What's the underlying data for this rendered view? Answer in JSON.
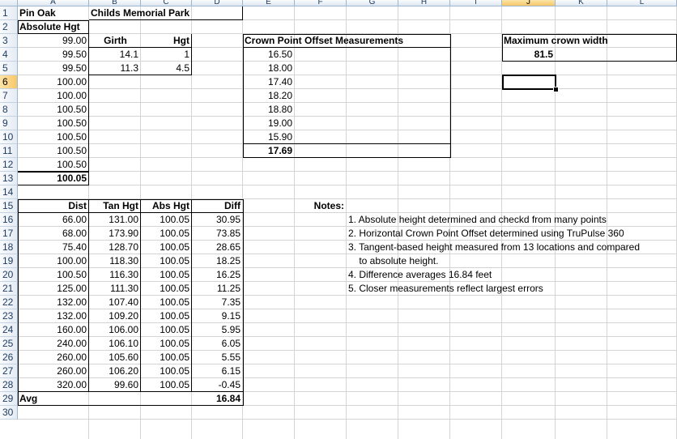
{
  "columns": [
    "A",
    "B",
    "C",
    "D",
    "E",
    "F",
    "G",
    "H",
    "I",
    "J",
    "K",
    "L"
  ],
  "rows": [
    "1",
    "2",
    "3",
    "4",
    "5",
    "6",
    "7",
    "8",
    "9",
    "10",
    "11",
    "12",
    "13",
    "14",
    "15",
    "16",
    "17",
    "18",
    "19",
    "20",
    "21",
    "22",
    "23",
    "24",
    "25",
    "26",
    "27",
    "28",
    "29",
    "30"
  ],
  "selected_cell": {
    "col": "J",
    "row": "6"
  },
  "header": {
    "species": "Pin Oak",
    "location": "Childs Memorial Park",
    "abs_hgt_label": "Absolute Hgt"
  },
  "absolute_heights": [
    "99.00",
    "99.50",
    "99.50",
    "100.00",
    "100.00",
    "100.50",
    "100.50",
    "100.50",
    "100.50",
    "100.50"
  ],
  "absolute_avg": "100.05",
  "girth_table": {
    "girth_label": "Girth",
    "hgt_label": "Hgt",
    "rows": [
      {
        "girth": "14.1",
        "hgt": "1"
      },
      {
        "girth": "11.3",
        "hgt": "4.5"
      }
    ]
  },
  "crown_offsets": {
    "title": "Crown Point Offset Measurements",
    "values": [
      "16.50",
      "18.00",
      "17.40",
      "18.20",
      "18.80",
      "19.00",
      "15.90"
    ],
    "average": "17.69"
  },
  "max_crown": {
    "title": "Maximum crown width",
    "value": "81.5"
  },
  "tan_table": {
    "headers": {
      "dist": "Dist",
      "tan": "Tan Hgt",
      "abs": "Abs Hgt",
      "diff": "Diff"
    },
    "rows": [
      {
        "dist": "66.00",
        "tan": "131.00",
        "abs": "100.05",
        "diff": "30.95"
      },
      {
        "dist": "68.00",
        "tan": "173.90",
        "abs": "100.05",
        "diff": "73.85"
      },
      {
        "dist": "75.40",
        "tan": "128.70",
        "abs": "100.05",
        "diff": "28.65"
      },
      {
        "dist": "100.00",
        "tan": "118.30",
        "abs": "100.05",
        "diff": "18.25"
      },
      {
        "dist": "100.50",
        "tan": "116.30",
        "abs": "100.05",
        "diff": "16.25"
      },
      {
        "dist": "125.00",
        "tan": "111.30",
        "abs": "100.05",
        "diff": "11.25"
      },
      {
        "dist": "132.00",
        "tan": "107.40",
        "abs": "100.05",
        "diff": "7.35"
      },
      {
        "dist": "132.00",
        "tan": "109.20",
        "abs": "100.05",
        "diff": "9.15"
      },
      {
        "dist": "160.00",
        "tan": "106.00",
        "abs": "100.05",
        "diff": "5.95"
      },
      {
        "dist": "240.00",
        "tan": "106.10",
        "abs": "100.05",
        "diff": "6.05"
      },
      {
        "dist": "260.00",
        "tan": "105.60",
        "abs": "100.05",
        "diff": "5.55"
      },
      {
        "dist": "260.00",
        "tan": "106.20",
        "abs": "100.05",
        "diff": "6.15"
      },
      {
        "dist": "320.00",
        "tan": "99.60",
        "abs": "100.05",
        "diff": "-0.45"
      }
    ],
    "avg_label": "Avg",
    "avg_diff": "16.84"
  },
  "notes": {
    "title": "Notes:",
    "lines": [
      "1. Absolute height determined and checkd from many points",
      "2. Horizontal Crown Point Offset determined using TruPulse 360",
      "3. Tangent-based height measured from 13 locations and compared",
      "    to absolute height.",
      "4. Difference averages 16.84 feet",
      "5. Closer measurements reflect largest errors"
    ]
  }
}
